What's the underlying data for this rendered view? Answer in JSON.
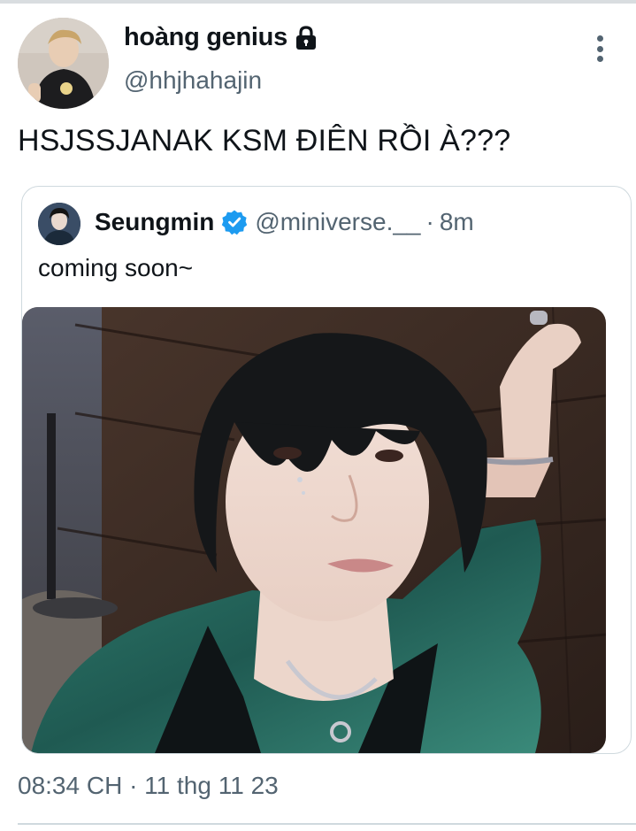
{
  "tweet": {
    "display_name": "hoàng genius",
    "handle": "@hhjhahajin",
    "text": "HSJSSJANAK KSM ĐIÊN RỒI À???",
    "timestamp": "08:34 CH · 11 thg 11 23",
    "protected_icon": "lock-icon",
    "menu_icon": "more-vertical-icon"
  },
  "quote": {
    "display_name": "Seungmin",
    "verified_icon": "verified-badge-icon",
    "handle": "@miniverse.__",
    "separator": "·",
    "time": "8m",
    "text": "coming soon~",
    "media": "selfie-photo"
  },
  "colors": {
    "text_primary": "#0f1419",
    "text_secondary": "#536471",
    "verified_blue": "#1d9bf0",
    "border": "#cfd9de"
  }
}
